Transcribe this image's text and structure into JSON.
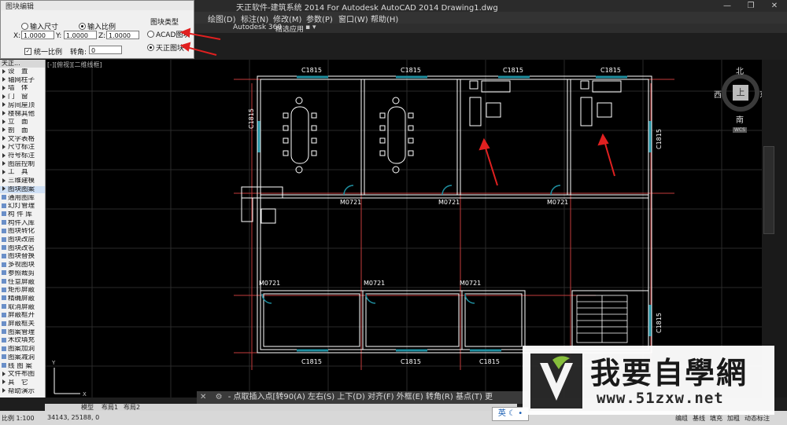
{
  "window": {
    "title": "天正软件-建筑系统 2014  For Autodesk AutoCAD 2014    Drawing1.dwg",
    "controls": [
      "—",
      "❐",
      "✕"
    ]
  },
  "menu": [
    "绘图(D)",
    "标注(N)",
    "修改(M)",
    "参数(P)",
    "窗口(W)",
    "帮助(H)"
  ],
  "ribbon": [
    "Autodesk 360",
    "精选应用"
  ],
  "dialog": {
    "title": "图块编辑",
    "input_size": "输入尺寸",
    "input_ratio": "输入比例",
    "x_label": "X:",
    "x_value": "1.0000",
    "y_label": "Y:",
    "y_value": "1.0000",
    "z_label": "Z:",
    "z_value": "1.0000",
    "uniform_ratio": "统一比例",
    "rotation_label": "转角:",
    "rotation_value": "0",
    "block_type_label": "图块类型",
    "acad_block": "ACAD图块",
    "tangent_block": "天正图块"
  },
  "palette": {
    "header": "天正...",
    "items": [
      {
        "label": "设　置",
        "kind": "menu"
      },
      {
        "label": "轴网柱子",
        "kind": "menu"
      },
      {
        "label": "墙　体",
        "kind": "menu"
      },
      {
        "label": "门　窗",
        "kind": "menu"
      },
      {
        "label": "房间屋顶",
        "kind": "menu"
      },
      {
        "label": "楼梯其他",
        "kind": "menu"
      },
      {
        "label": "立　面",
        "kind": "menu"
      },
      {
        "label": "剖　面",
        "kind": "menu"
      },
      {
        "label": "文字表格",
        "kind": "menu"
      },
      {
        "label": "尺寸标注",
        "kind": "menu"
      },
      {
        "label": "符号标注",
        "kind": "menu"
      },
      {
        "label": "图层控制",
        "kind": "menu"
      },
      {
        "label": "工　具",
        "kind": "menu"
      },
      {
        "label": "三维建模",
        "kind": "menu"
      },
      {
        "label": "图块图案",
        "kind": "open"
      },
      {
        "label": "通用图库",
        "kind": "cmd"
      },
      {
        "label": "幻灯管理",
        "kind": "cmd"
      },
      {
        "label": "构 件 库",
        "kind": "cmd"
      },
      {
        "label": "构件入库",
        "kind": "cmd"
      },
      {
        "label": "图块转化",
        "kind": "cmd"
      },
      {
        "label": "图块改层",
        "kind": "cmd"
      },
      {
        "label": "图块改名",
        "kind": "cmd"
      },
      {
        "label": "图块替换",
        "kind": "cmd"
      },
      {
        "label": "多视图块",
        "kind": "cmd"
      },
      {
        "label": "参照裁剪",
        "kind": "cmd"
      },
      {
        "label": "任意屏蔽",
        "kind": "cmd"
      },
      {
        "label": "矩形屏蔽",
        "kind": "cmd"
      },
      {
        "label": "精确屏蔽",
        "kind": "cmd"
      },
      {
        "label": "取消屏蔽",
        "kind": "cmd"
      },
      {
        "label": "屏蔽框开",
        "kind": "cmd"
      },
      {
        "label": "屏蔽框关",
        "kind": "cmd"
      },
      {
        "label": "图案管理",
        "kind": "cmd"
      },
      {
        "label": "木纹填充",
        "kind": "cmd"
      },
      {
        "label": "图案加洞",
        "kind": "cmd"
      },
      {
        "label": "图案减洞",
        "kind": "cmd"
      },
      {
        "label": "线 图 案",
        "kind": "cmd"
      },
      {
        "label": "文件布图",
        "kind": "menu"
      },
      {
        "label": "其　它",
        "kind": "menu"
      },
      {
        "label": "帮助演示",
        "kind": "menu"
      }
    ]
  },
  "view_label": "[-][俯视][二维线框]",
  "compass": {
    "north": "北",
    "south": "南",
    "east": "东",
    "west": "西",
    "top": "上",
    "wcs": "WCS"
  },
  "drawing": {
    "window_label": "C1815",
    "door_label": "M0721"
  },
  "command_line": "- 点取插入点[转90(A) 左右(S) 上下(D) 对齐(F) 外框(E) 转角(R) 基点(T) 更",
  "layout_tabs": [
    "模型",
    "布局1",
    "布局2"
  ],
  "status": {
    "scale": "比例 1:100",
    "coords": "34143, 25188, 0",
    "right": [
      "编组",
      "基线",
      "填充",
      "加粗",
      "动态标注"
    ]
  },
  "ime": "英",
  "watermark": {
    "title": "我要自學網",
    "url": "www.51zxw.net"
  },
  "colors": {
    "wall": "#ffffff",
    "room_line": "#c43c3c",
    "window": "#1f8fa0",
    "accent_arrow": "#e02020"
  }
}
